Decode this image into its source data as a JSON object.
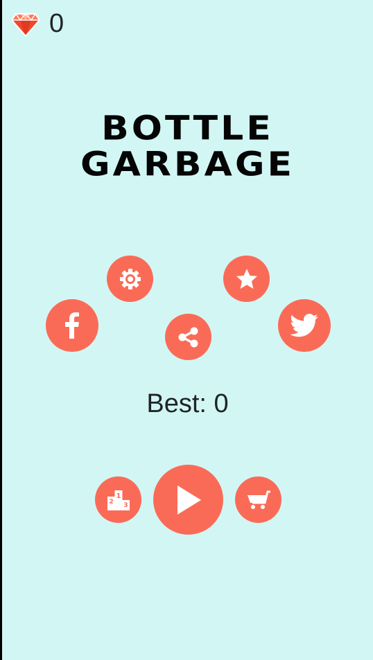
{
  "hud": {
    "gems_count": "0",
    "gem_icon": "gem-icon",
    "gem_color": "#f0482c"
  },
  "title": {
    "line1": "BOTTLE",
    "line2": "GARBAGE"
  },
  "buttons": [
    {
      "name": "settings-button",
      "icon": "gear-icon"
    },
    {
      "name": "rate-button",
      "icon": "star-icon"
    },
    {
      "name": "facebook-button",
      "icon": "facebook-icon"
    },
    {
      "name": "share-button",
      "icon": "share-icon"
    },
    {
      "name": "twitter-button",
      "icon": "twitter-icon"
    },
    {
      "name": "leaderboard-button",
      "icon": "podium-icon"
    },
    {
      "name": "play-button",
      "icon": "play-icon"
    },
    {
      "name": "shop-button",
      "icon": "cart-icon"
    }
  ],
  "best": {
    "label": "Best: ",
    "value": "0"
  },
  "colors": {
    "background": "#d2f6f4",
    "accent": "#fa6b57",
    "text": "#1f2426",
    "title": "#050505"
  }
}
